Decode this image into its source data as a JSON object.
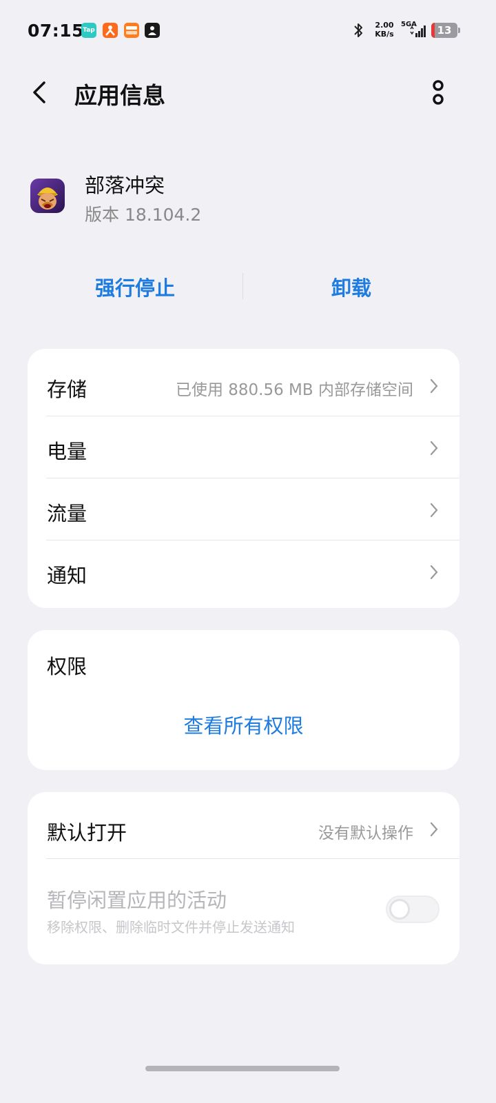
{
  "status_bar": {
    "time": "07:15",
    "notifications": [
      {
        "icon": "taptap-icon",
        "text": "Tap"
      },
      {
        "icon": "orange-app-icon",
        "text": ""
      },
      {
        "icon": "taobao-shangou-icon",
        "text": ""
      },
      {
        "icon": "dark-app-icon",
        "text": ""
      }
    ],
    "speed_value": "2.00",
    "speed_unit": "KB/s",
    "network": "5GA",
    "battery": "13"
  },
  "header": {
    "title": "应用信息"
  },
  "app": {
    "name": "部落冲突",
    "version": "版本 18.104.2"
  },
  "actions": {
    "force_stop": "强行停止",
    "uninstall": "卸载"
  },
  "settings": [
    {
      "label": "存储",
      "value": "已使用 880.56 MB 内部存储空间"
    },
    {
      "label": "电量",
      "value": ""
    },
    {
      "label": "流量",
      "value": ""
    },
    {
      "label": "通知",
      "value": ""
    }
  ],
  "permissions": {
    "title": "权限",
    "link": "查看所有权限"
  },
  "defaults": {
    "open_by_default_label": "默认打开",
    "open_by_default_value": "没有默认操作",
    "pause_title": "暂停闲置应用的活动",
    "pause_subtitle": "移除权限、删除临时文件并停止发送通知",
    "pause_enabled": false
  },
  "colors": {
    "accent": "#1e7be0",
    "background": "#f1f1f5"
  }
}
